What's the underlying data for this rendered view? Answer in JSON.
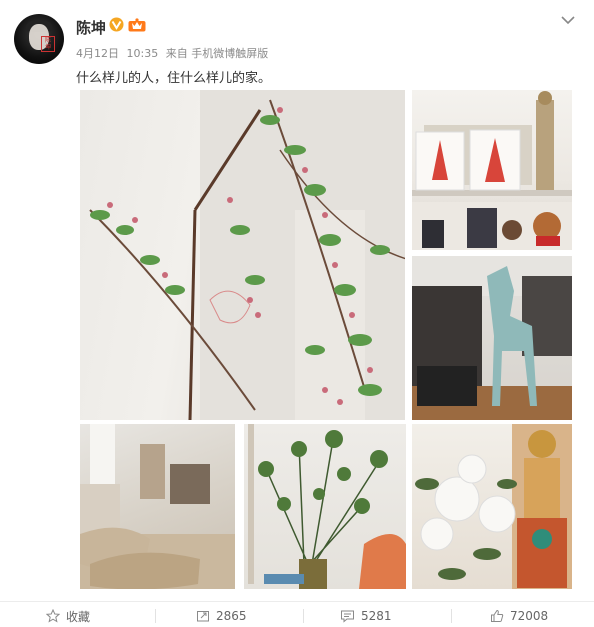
{
  "post": {
    "author": "陈坤",
    "date": "4月12日",
    "time": "10:35",
    "source_prefix": "来自",
    "source": "手机微博触屏版",
    "text": "什么样儿的人，住什么样儿的家。"
  },
  "icons": {
    "verified": "verified-v-icon",
    "member": "member-crown-icon",
    "more": "chevron-down-icon"
  },
  "photos": [
    {
      "subject": "flowering branch"
    },
    {
      "subject": "shelf with paper-cut art and figurines"
    },
    {
      "subject": "wardrobe and blue horse statue"
    },
    {
      "subject": "cushions on floor"
    },
    {
      "subject": "green branches in vase"
    },
    {
      "subject": "white flowers and buddha statue"
    }
  ],
  "actions": {
    "favorite_label": "收藏",
    "repost_count": "2865",
    "comment_count": "5281",
    "like_count": "72008"
  },
  "colors": {
    "verified": "#f5a623",
    "member": "#ff7a1a",
    "text_primary": "#333333",
    "text_meta": "#8a8a8a"
  }
}
